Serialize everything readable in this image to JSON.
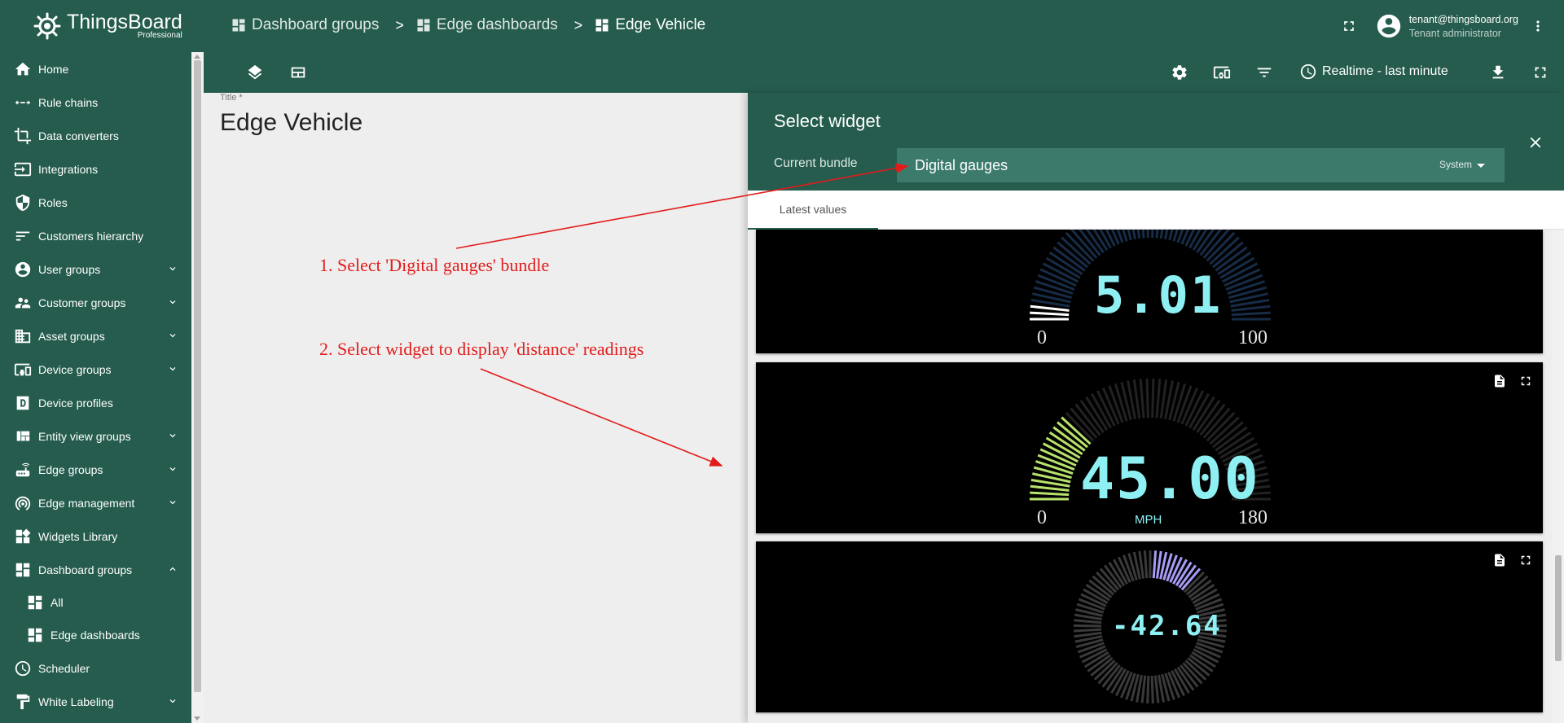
{
  "app": {
    "name": "ThingsBoard",
    "edition": "Professional"
  },
  "sidebar": {
    "items": [
      {
        "label": "Home",
        "icon": "home-icon",
        "expandable": false
      },
      {
        "label": "Rule chains",
        "icon": "rule-chains-icon",
        "expandable": false
      },
      {
        "label": "Data converters",
        "icon": "crop-icon",
        "expandable": false
      },
      {
        "label": "Integrations",
        "icon": "input-icon",
        "expandable": false
      },
      {
        "label": "Roles",
        "icon": "shield-icon",
        "expandable": false
      },
      {
        "label": "Customers hierarchy",
        "icon": "sort-icon",
        "expandable": false
      },
      {
        "label": "User groups",
        "icon": "account-circle-icon",
        "expandable": true
      },
      {
        "label": "Customer groups",
        "icon": "supervisor-icon",
        "expandable": true
      },
      {
        "label": "Asset groups",
        "icon": "domain-icon",
        "expandable": true
      },
      {
        "label": "Device groups",
        "icon": "devices-icon",
        "expandable": true
      },
      {
        "label": "Device profiles",
        "icon": "device-profile-icon",
        "expandable": false
      },
      {
        "label": "Entity view groups",
        "icon": "view-quilt-icon",
        "expandable": true
      },
      {
        "label": "Edge groups",
        "icon": "router-icon",
        "expandable": true
      },
      {
        "label": "Edge management",
        "icon": "wifi-tethering-icon",
        "expandable": true
      },
      {
        "label": "Widgets Library",
        "icon": "widgets-icon",
        "expandable": false
      },
      {
        "label": "Dashboard groups",
        "icon": "dashboard-icon",
        "expandable": true,
        "expanded": true
      },
      {
        "label": "All",
        "icon": "dashboard-icon",
        "sub": true
      },
      {
        "label": "Edge dashboards",
        "icon": "dashboard-icon",
        "sub": true
      },
      {
        "label": "Scheduler",
        "icon": "schedule-icon",
        "expandable": false
      },
      {
        "label": "White Labeling",
        "icon": "format-paint-icon",
        "expandable": true
      }
    ]
  },
  "breadcrumb": [
    {
      "label": "Dashboard groups"
    },
    {
      "label": "Edge dashboards"
    },
    {
      "label": "Edge Vehicle"
    }
  ],
  "breadcrumb_separator": ">",
  "user": {
    "email": "tenant@thingsboard.org",
    "role": "Tenant administrator"
  },
  "toolbar": {
    "timewindow": "Realtime - last minute"
  },
  "dashboard": {
    "title_label": "Title *",
    "title": "Edge Vehicle"
  },
  "annotations": [
    "1. Select 'Digital gauges' bundle",
    "2. Select widget to display 'distance' readings"
  ],
  "select_widget": {
    "title": "Select widget",
    "bundle_label": "Current bundle",
    "bundle_value": "Digital gauges",
    "bundle_scope": "System",
    "tab": "Latest values"
  },
  "widgets": [
    {
      "value": "5.01",
      "min": "0",
      "max": "100",
      "unit": "",
      "fill": 0.05,
      "color": "#ffffff"
    },
    {
      "value": "45.00",
      "min": "0",
      "max": "180",
      "unit": "MPH",
      "fill": 0.25,
      "color": "#b7e26b"
    },
    {
      "value": "-42.64",
      "min": "",
      "max": "",
      "unit": "",
      "fill": 0.12,
      "color": "#a79cf6"
    }
  ],
  "colors": {
    "primary": "#255c4e",
    "accent_bar": "#3c7b6b",
    "digits": "#8ef0f3",
    "annotation": "#e31b1b"
  }
}
